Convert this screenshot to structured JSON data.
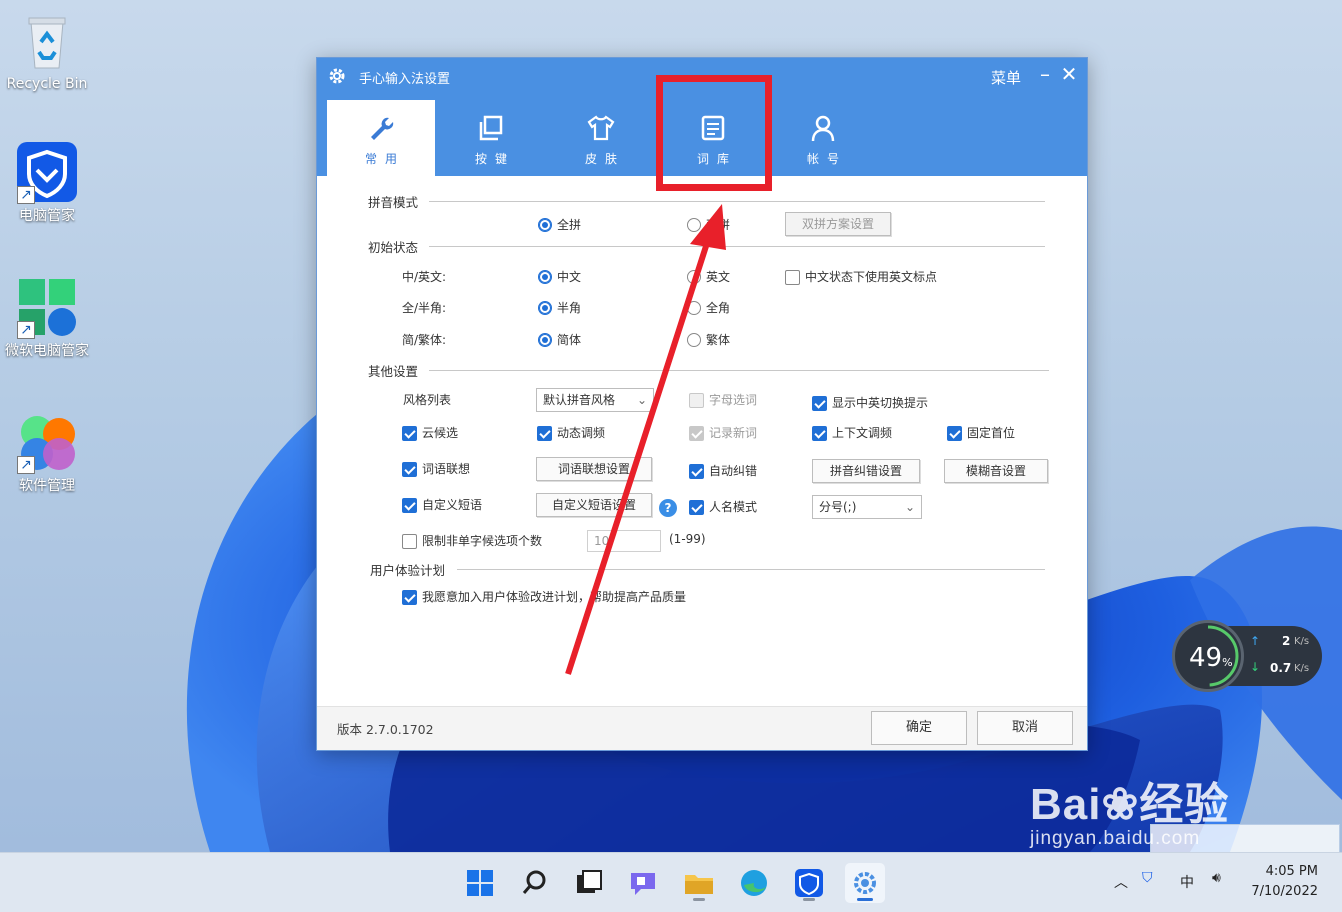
{
  "desktop": {
    "icons": [
      {
        "label": "Recycle Bin"
      },
      {
        "label": "电脑管家"
      },
      {
        "label": "微软电脑管家"
      },
      {
        "label": "软件管理"
      }
    ]
  },
  "window": {
    "title": "手心输入法设置",
    "menu_label": "菜单",
    "minimize_glyph": "–",
    "close_glyph": "✕",
    "tabs": [
      {
        "label": "常用",
        "icon": "wrench-icon",
        "active": true
      },
      {
        "label": "按键",
        "icon": "keys-icon",
        "active": false
      },
      {
        "label": "皮肤",
        "icon": "shirt-icon",
        "active": false
      },
      {
        "label": "词库",
        "icon": "document-icon",
        "active": false
      },
      {
        "label": "帐号",
        "icon": "user-icon",
        "active": false
      }
    ],
    "sections": {
      "pinyin_mode": {
        "title": "拼音模式",
        "full": "全拼",
        "double": "双拼",
        "double_button": "双拼方案设置"
      },
      "initial_state": {
        "title": "初始状态",
        "row1": {
          "label": "中/英文:",
          "opt1": "中文",
          "opt2": "英文",
          "extra": "中文状态下使用英文标点"
        },
        "row2": {
          "label": "全/半角:",
          "opt1": "半角",
          "opt2": "全角"
        },
        "row3": {
          "label": "简/繁体:",
          "opt1": "简体",
          "opt2": "繁体"
        }
      },
      "other": {
        "title": "其他设置",
        "style_list_label": "风格列表",
        "style_value": "默认拼音风格",
        "letter_select": "字母选词",
        "show_switch_tip": "显示中英切换提示",
        "cloud": "云候选",
        "dynamic_freq": "动态调频",
        "record_new": "记录新词",
        "context_freq": "上下文调频",
        "fixed_first": "固定首位",
        "word_assoc": "词语联想",
        "word_assoc_btn": "词语联想设置",
        "auto_correct": "自动纠错",
        "pinyin_correct_btn": "拼音纠错设置",
        "fuzzy_btn": "模糊音设置",
        "custom_phrase": "自定义短语",
        "custom_phrase_btn": "自定义短语设置",
        "help_glyph": "?",
        "name_mode": "人名模式",
        "separator_value": "分号(;)",
        "limit_label": "限制非单字候选项个数",
        "limit_value": "10",
        "limit_range": "(1-99)"
      },
      "ux": {
        "title": "用户体验计划",
        "join": "我愿意加入用户体验改进计划，帮助提高产品质量"
      }
    },
    "version": "版本  2.7.0.1702",
    "ok": "确定",
    "cancel": "取消"
  },
  "speed_widget": {
    "percent": "49",
    "percent_unit": "%",
    "up": "2",
    "up_unit": "K/s",
    "down": "0.7",
    "down_unit": "K/s"
  },
  "watermark": {
    "brand": "Bai",
    "cn": "经验",
    "url": "jingyan.baidu.com"
  },
  "tray": {
    "ime": "中",
    "time": "4:05 PM",
    "date": "7/10/2022"
  },
  "colors": {
    "accent": "#4a90e2",
    "highlight": "#e8202a"
  }
}
